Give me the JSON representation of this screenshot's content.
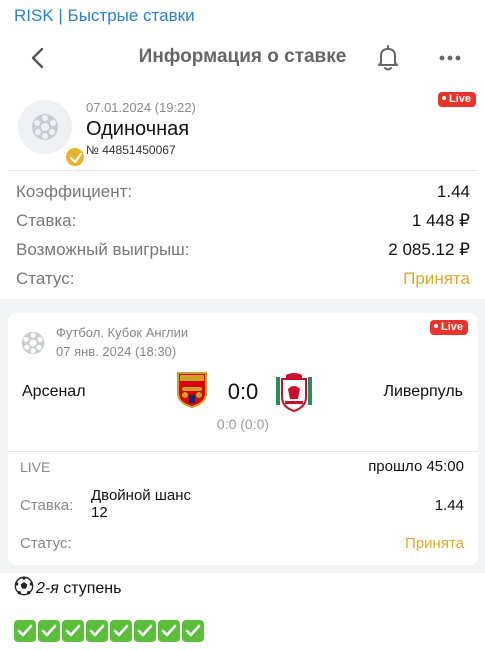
{
  "channel": {
    "title": "RISK | Быстрые ставки"
  },
  "header": {
    "title": "Информация о ставке"
  },
  "bet": {
    "date": "07.01.2024 (19:22)",
    "type": "Одиночная",
    "number": "№ 44851450067",
    "live_badge": "Live"
  },
  "details": {
    "rows": [
      {
        "label": "Коэффициент:",
        "value": "1.44"
      },
      {
        "label": "Ставка:",
        "value": "1 448 ₽"
      },
      {
        "label": "Возможный выигрыш:",
        "value": "2 085.12 ₽"
      },
      {
        "label": "Статус:",
        "value": "Принята"
      }
    ]
  },
  "event": {
    "league": "Футбол. Кубок Англии",
    "date": "07 янв. 2024 (18:30)",
    "live_badge": "Live",
    "home_team": "Арсенал",
    "away_team": "Ливерпуль",
    "score": "0:0",
    "score_detail": "0:0 (0:0)",
    "live_label": "LIVE",
    "elapsed": "прошло 45:00",
    "stake_label": "Ставка:",
    "market_line1": "Двойной шанс",
    "market_line2": "12",
    "odds": "1.44",
    "status_label": "Статус:",
    "status_value": "Принята"
  },
  "footer": {
    "step_number": "2-я",
    "step_text": "ступень",
    "checks_count": 8
  },
  "colors": {
    "accent": "#e0a82e",
    "live": "#e8332a",
    "check": "#5cbf3c",
    "channel": "#2b7fc4"
  },
  "icons": [
    "back-arrow-icon",
    "bell-icon",
    "more-icon",
    "soccer-ball-icon",
    "check-badge-icon",
    "arsenal-crest-icon",
    "liverpool-crest-icon",
    "green-check-icon"
  ]
}
